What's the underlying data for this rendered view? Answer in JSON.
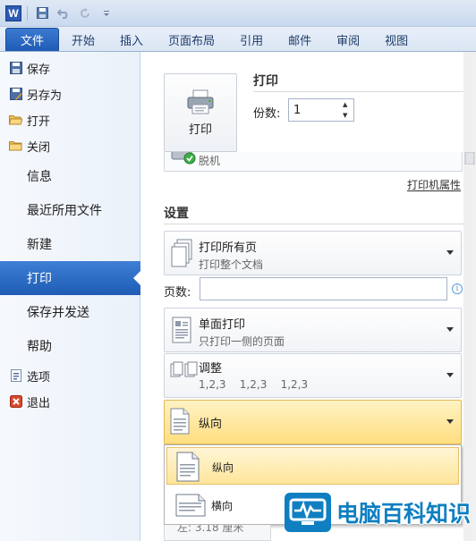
{
  "titlebar": {
    "app_icon": "W",
    "icons": [
      "word-icon",
      "save-icon",
      "undo-icon",
      "redo-icon",
      "customize-qat-icon"
    ]
  },
  "tabs": [
    "文件",
    "开始",
    "插入",
    "页面布局",
    "引用",
    "邮件",
    "审阅",
    "视图"
  ],
  "nav": {
    "commands": [
      {
        "label": "保存",
        "icon": "save-icon"
      },
      {
        "label": "另存为",
        "icon": "save-as-icon"
      },
      {
        "label": "打开",
        "icon": "open-folder-icon"
      },
      {
        "label": "关闭",
        "icon": "close-folder-icon"
      }
    ],
    "items": [
      "信息",
      "最近所用文件",
      "新建",
      "打印",
      "保存并发送",
      "帮助"
    ],
    "bottom_commands": [
      {
        "label": "选项",
        "icon": "options-icon"
      },
      {
        "label": "退出",
        "icon": "exit-icon"
      }
    ],
    "active": "打印"
  },
  "print": {
    "button_label": "打印",
    "heading": "打印",
    "copies_label": "份数:",
    "copies_value": "1",
    "printer_status": "脱机",
    "printer_properties": "打印机属性"
  },
  "settings": {
    "heading": "设置",
    "print_range": {
      "title": "打印所有页",
      "subtitle": "打印整个文档"
    },
    "pages_label": "页数:",
    "pages_value": "",
    "sides": {
      "title": "单面打印",
      "subtitle": "只打印一侧的页面"
    },
    "collate": {
      "title": "调整",
      "subtitle": "1,2,3    1,2,3    1,2,3"
    },
    "orientation": {
      "title": "纵向"
    },
    "orientation_options": [
      "纵向",
      "横向"
    ],
    "bottom_partial": "左: 3.18 厘米"
  },
  "watermark": {
    "text": "电脑百科知识"
  },
  "colors": {
    "accent": "#2a62bc",
    "highlight": "#ffde7f",
    "watermark": "#0f7fc1"
  }
}
